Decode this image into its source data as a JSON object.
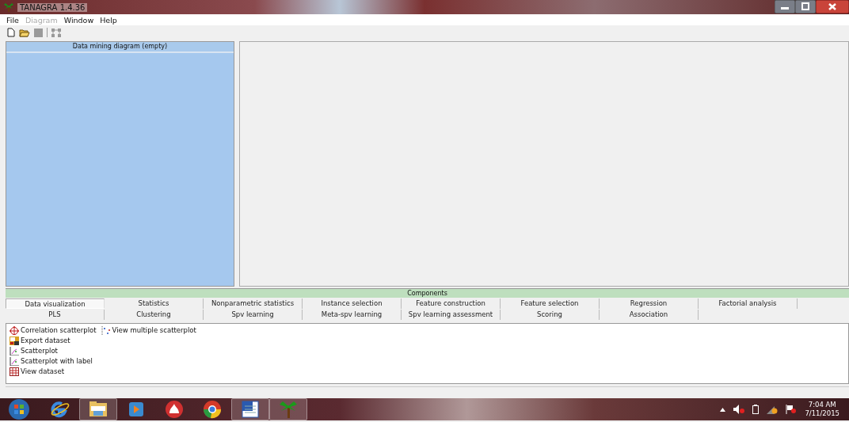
{
  "window": {
    "title": "TANAGRA 1.4.36"
  },
  "menu": [
    {
      "label": "File",
      "disabled": false
    },
    {
      "label": "Diagram",
      "disabled": true
    },
    {
      "label": "Window",
      "disabled": false
    },
    {
      "label": "Help",
      "disabled": false
    }
  ],
  "diagram_panel": {
    "title": "Data mining diagram (empty)"
  },
  "components": {
    "title": "Components",
    "tab_rows": [
      [
        {
          "label": "Data visualization",
          "selected": true
        },
        {
          "label": "Statistics",
          "selected": false
        },
        {
          "label": "Nonparametric statistics",
          "selected": false
        },
        {
          "label": "Instance selection",
          "selected": false
        },
        {
          "label": "Feature construction",
          "selected": false
        },
        {
          "label": "Feature selection",
          "selected": false
        },
        {
          "label": "Regression",
          "selected": false
        },
        {
          "label": "Factorial analysis",
          "selected": false
        }
      ],
      [
        {
          "label": "PLS",
          "selected": false
        },
        {
          "label": "Clustering",
          "selected": false
        },
        {
          "label": "Spv learning",
          "selected": false
        },
        {
          "label": "Meta-spv learning",
          "selected": false
        },
        {
          "label": "Spv learning assessment",
          "selected": false
        },
        {
          "label": "Scoring",
          "selected": false
        },
        {
          "label": "Association",
          "selected": false
        }
      ]
    ],
    "item_columns": [
      [
        {
          "label": "Correlation scatterplot",
          "kind": "crosshair"
        },
        {
          "label": "Export dataset",
          "kind": "export"
        },
        {
          "label": "Scatterplot",
          "kind": "plot"
        },
        {
          "label": "Scatterplot with label",
          "kind": "plot"
        },
        {
          "label": "View dataset",
          "kind": "grid"
        }
      ],
      [
        {
          "label": "View multiple scatterplot",
          "kind": "dots"
        }
      ]
    ]
  },
  "taskbar": {
    "apps": [
      {
        "kind": "ie",
        "running": false
      },
      {
        "kind": "folder",
        "running": true
      },
      {
        "kind": "media",
        "running": false
      },
      {
        "kind": "flame",
        "running": false
      },
      {
        "kind": "chrome",
        "running": false
      },
      {
        "kind": "word",
        "running": true
      },
      {
        "kind": "palm",
        "running": true
      }
    ],
    "time": "7:04 AM",
    "date": "7/11/2015"
  }
}
